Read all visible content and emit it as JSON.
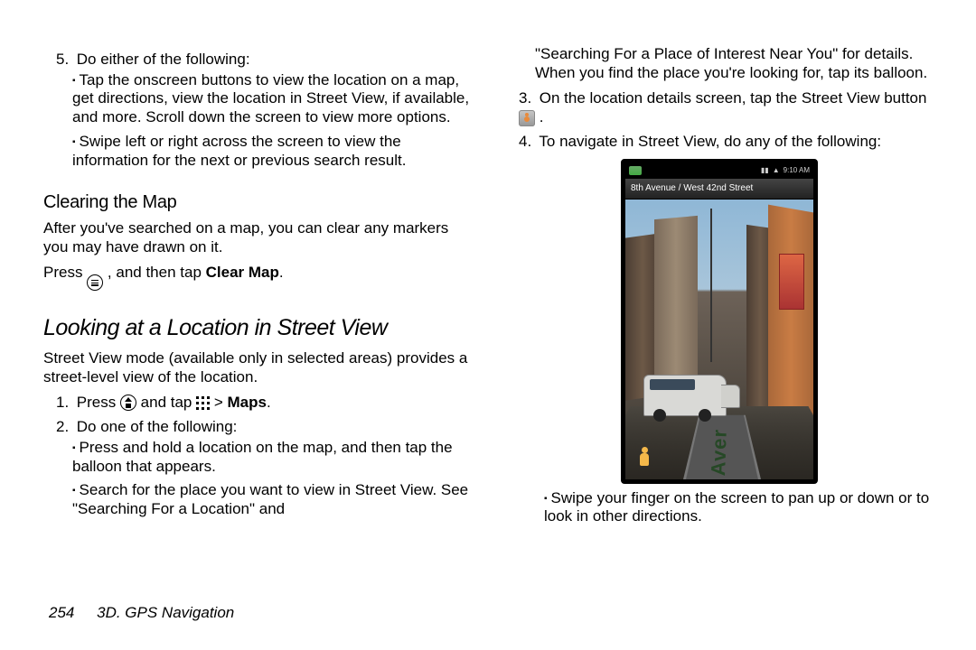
{
  "left": {
    "item5": {
      "num": "5.",
      "text": "Do either of the following:",
      "b1": "Tap the onscreen buttons to view the location on a map, get directions, view the location in Street View, if available, and more. Scroll down the screen to view more options.",
      "b2": "Swipe left or right across the screen to view the information for the next or previous search result."
    },
    "clearing": {
      "title": "Clearing the Map",
      "para": "After you've searched on a map, you can clear any markers you may have drawn on it.",
      "instr_pre": "Press ",
      "instr_mid": ", and then tap ",
      "instr_bold": "Clear Map",
      "instr_post": "."
    },
    "sv": {
      "title": "Looking at a Location in Street View",
      "para": "Street View mode (available only in selected areas) provides a street-level view of the location.",
      "s1": {
        "num": "1.",
        "pre": "Press ",
        "mid": " and tap ",
        "arrow": " > ",
        "bold": "Maps",
        "post": "."
      },
      "s2": {
        "num": "2.",
        "text": "Do one of the following:"
      },
      "s2b1": "Press and hold a location on the map, and then tap the balloon that appears.",
      "s2b2": "Search for the place you want to view in Street View. See \"Searching For a Location\" and"
    }
  },
  "right": {
    "cont": "\"Searching For a Place of Interest Near You\" for details. When you find the place you're looking for, tap its balloon.",
    "s3": {
      "num": "3.",
      "pre": "On the location details screen, tap the Street View button ",
      "post": "."
    },
    "s4": {
      "num": "4.",
      "text": "To navigate in Street View, do any of the following:"
    },
    "phone": {
      "time": "9:10 AM",
      "address": "8th Avenue / West 42nd Street",
      "road": "n Aver"
    },
    "b1": "Swipe your finger on the screen to pan up or down or to look in other directions."
  },
  "footer": {
    "page": "254",
    "section": "3D. GPS Navigation"
  }
}
